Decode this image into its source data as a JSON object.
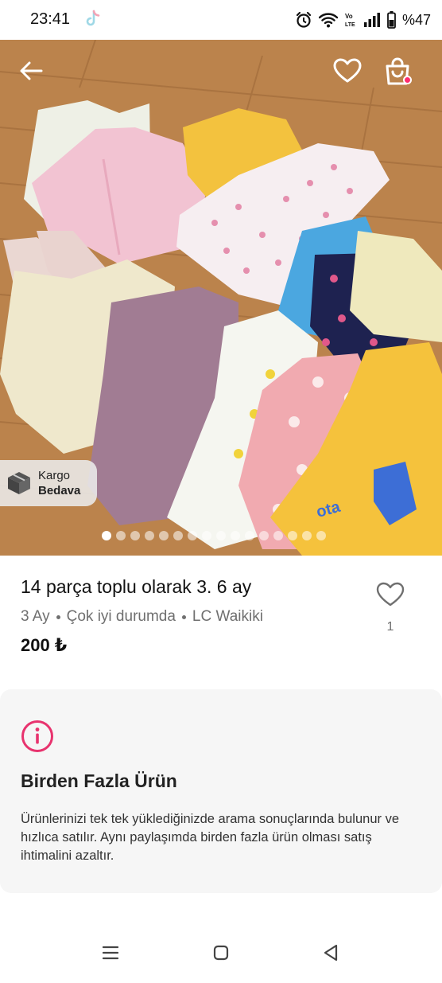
{
  "status_bar": {
    "time": "23:41",
    "battery": "%47",
    "icons": [
      "tiktok-icon",
      "alarm-icon",
      "wifi-icon",
      "volte-icon",
      "signal-icon",
      "battery-icon"
    ]
  },
  "hero": {
    "icons": [
      "back-arrow-icon",
      "heart-icon",
      "shopping-bag-icon"
    ],
    "badge": {
      "line1": "Kargo",
      "line2": "Bedava",
      "icon": "package-box-icon"
    },
    "carousel": {
      "total": 16,
      "active": 1
    }
  },
  "product": {
    "title": "14 parça toplu olarak 3. 6 ay",
    "size": "3 Ay",
    "condition": "Çok iyi durumda",
    "brand": "LC Waikiki",
    "price": "200 ₺",
    "like_count": "1"
  },
  "info_card": {
    "icon": "info-icon",
    "accent": "#e8336e",
    "title": "Birden Fazla Ürün",
    "body": "Ürünlerinizi tek tek yüklediğinizde arama sonuçlarında bulunur ve hızlıca satılır. Aynı paylaşımda birden fazla ürün olması satış ihtimalini azaltır."
  },
  "nav": {
    "icons": [
      "recent-apps-icon",
      "home-icon",
      "back-icon"
    ]
  }
}
